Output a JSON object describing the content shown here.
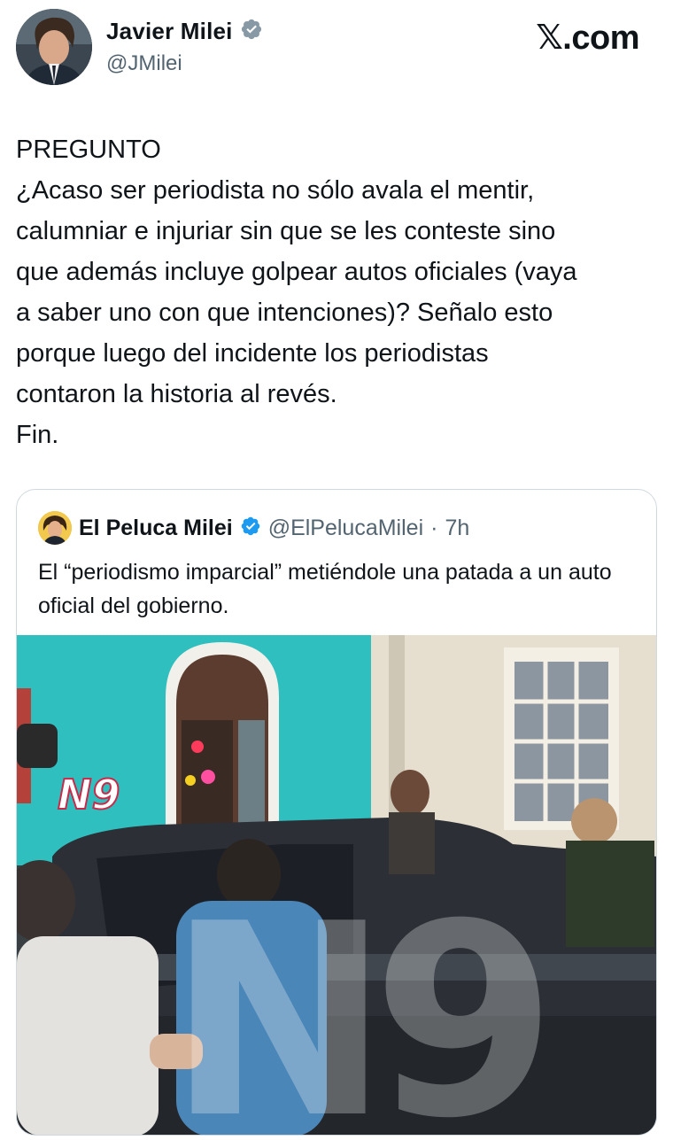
{
  "brand": "𝕏.com",
  "author": {
    "display_name": "Javier Milei",
    "handle": "@JMilei",
    "verified": true
  },
  "tweet": {
    "text": "PREGUNTO\n¿Acaso ser periodista no sólo avala el mentir,\ncalumniar e injuriar sin que se les conteste sino\nque además incluye golpear autos oficiales (vaya\na saber uno con que intenciones)? Señalo esto\nporque luego del incidente los periodistas\ncontaron la historia al revés.\nFin."
  },
  "quoted": {
    "display_name": "El Peluca Milei",
    "handle": "@ElPelucaMilei",
    "separator": "·",
    "time": "7h",
    "verified": true,
    "text": "El “periodismo imparcial” metiéndole una patada a un auto oficial del gobierno.",
    "media": {
      "watermark_small": "N9",
      "watermark_large": "N9"
    }
  },
  "colors": {
    "verified_badge": "#1d9bf0",
    "text_primary": "#0f1419",
    "text_secondary": "#536471",
    "border": "#cfd9de"
  },
  "icons": [
    "verified-badge-icon"
  ]
}
